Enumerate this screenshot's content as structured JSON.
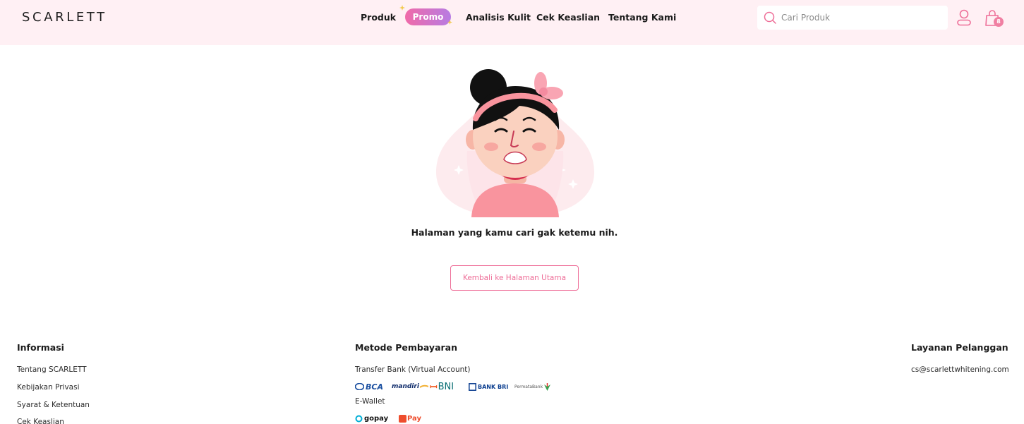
{
  "header": {
    "logo": "SCARLETT",
    "nav": {
      "produk": "Produk",
      "promo": "Promo",
      "analisis": "Analisis Kulit",
      "cek": "Cek Keaslian",
      "tentang": "Tentang Kami"
    },
    "search": {
      "placeholder": "Cari Produk"
    },
    "cart_count": "8"
  },
  "main": {
    "message": "Halaman yang kamu cari gak ketemu nih.",
    "back_button": "Kembali ke Halaman Utama"
  },
  "footer": {
    "info": {
      "heading": "Informasi",
      "links": [
        "Tentang SCARLETT",
        "Kebijakan Privasi",
        "Syarat & Ketentuan",
        "Cek Keaslian"
      ]
    },
    "payment": {
      "heading": "Metode Pembayaran",
      "bank_label": "Transfer Bank (Virtual Account)",
      "banks": [
        "BCA",
        "mandiri",
        "BNI",
        "BANK BRI",
        "PermataBank"
      ],
      "ewallet_label": "E-Wallet",
      "ewallets": [
        "gopay",
        "Pay"
      ]
    },
    "service": {
      "heading": "Layanan Pelanggan",
      "email": "cs@scarlettwhitening.com"
    }
  },
  "colors": {
    "header_bg": "#fff0f4",
    "accent_pink": "#ee6e98",
    "promo_gradient_start": "#f06aa8",
    "promo_gradient_end": "#b77ce3"
  },
  "icons": [
    "search-icon",
    "user-icon",
    "shopping-bag-icon",
    "sparkle-icon"
  ]
}
